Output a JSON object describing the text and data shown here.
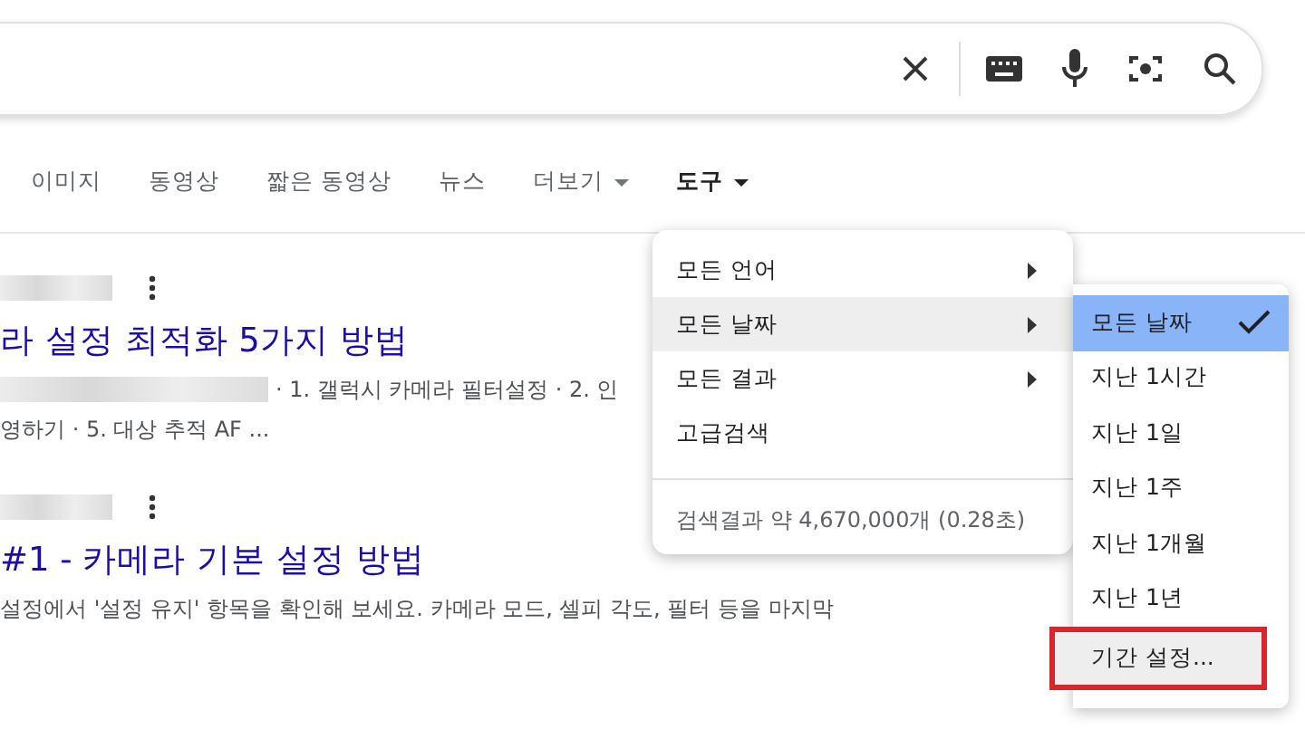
{
  "tabs": [
    {
      "label": "이미지",
      "selected": false,
      "dropdown": false
    },
    {
      "label": "동영상",
      "selected": false,
      "dropdown": false
    },
    {
      "label": "짧은 동영상",
      "selected": false,
      "dropdown": false
    },
    {
      "label": "뉴스",
      "selected": false,
      "dropdown": false
    },
    {
      "label": "더보기",
      "selected": false,
      "dropdown": true
    },
    {
      "label": "도구",
      "selected": true,
      "dropdown": true
    }
  ],
  "results": [
    {
      "title": "라 설정 최적화 5가지 방법",
      "snippet": [
        "· 1. 갤럭시 카메라 필터설정 · 2. 인",
        "영하기 · 5. 대상 추적 AF ..."
      ]
    },
    {
      "title": "#1 - 카메라 기본 설정 방법",
      "snippet": [
        "설정에서 '설정 유지' 항목을 확인해 보세요. 카메라 모드, 셀피 각도, 필터 등을 마지막"
      ]
    }
  ],
  "tools_menu": {
    "items": [
      {
        "label": "모든 언어",
        "submenu": true,
        "expanded": false
      },
      {
        "label": "모든 날짜",
        "submenu": true,
        "expanded": true
      },
      {
        "label": "모든 결과",
        "submenu": true,
        "expanded": false
      },
      {
        "label": "고급검색",
        "submenu": false,
        "expanded": false
      }
    ],
    "stats": "검색결과 약 4,670,000개 (0.28초)"
  },
  "date_menu": {
    "items": [
      {
        "label": "모든 날짜",
        "selected": true,
        "highlighted": false,
        "outlined": false
      },
      {
        "label": "지난 1시간",
        "selected": false,
        "highlighted": false,
        "outlined": false
      },
      {
        "label": "지난 1일",
        "selected": false,
        "highlighted": false,
        "outlined": false
      },
      {
        "label": "지난 1주",
        "selected": false,
        "highlighted": false,
        "outlined": false
      },
      {
        "label": "지난 1개월",
        "selected": false,
        "highlighted": false,
        "outlined": false
      },
      {
        "label": "지난 1년",
        "selected": false,
        "highlighted": false,
        "outlined": false
      },
      {
        "label": "기간 설정...",
        "selected": false,
        "highlighted": true,
        "outlined": true
      }
    ]
  }
}
